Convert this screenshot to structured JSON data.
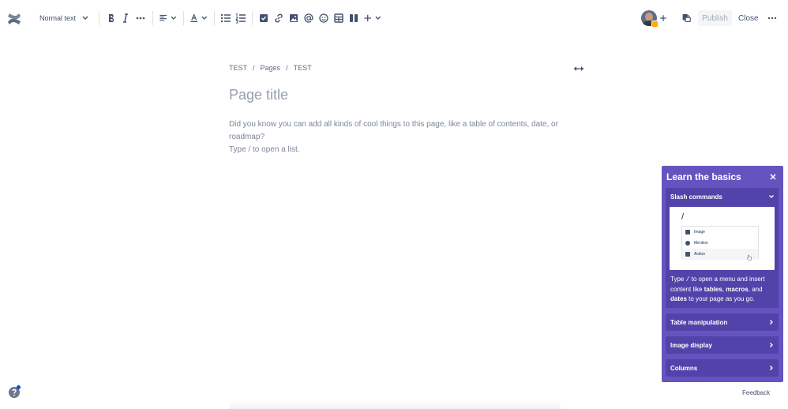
{
  "toolbar": {
    "text_style": "Normal text",
    "publish_label": "Publish",
    "close_label": "Close",
    "icons": [
      "confluence-logo-icon",
      "bold-icon",
      "italic-icon",
      "more-formatting-icon",
      "align-icon",
      "text-color-icon",
      "bullet-list-icon",
      "numbered-list-icon",
      "action-item-icon",
      "link-icon",
      "image-icon",
      "mention-icon",
      "emoji-icon",
      "table-icon",
      "layouts-icon",
      "insert-icon",
      "avatar",
      "invite-icon",
      "restrictions-icon",
      "more-icon"
    ]
  },
  "breadcrumb": {
    "items": [
      "TEST",
      "Pages",
      "TEST"
    ]
  },
  "editor": {
    "title_placeholder": "Page title",
    "body_placeholder_line1": "Did you know you can add all kinds of cool things to this page, like a table of contents, date, or roadmap?",
    "body_placeholder_line2": "Type / to open a list."
  },
  "learn_panel": {
    "title": "Learn the basics",
    "sections": [
      {
        "label": "Slash commands",
        "expanded": true,
        "demo": {
          "slash": "/",
          "menu": [
            "Image",
            "Mention",
            "Action"
          ]
        },
        "text": {
          "part1": "Type ",
          "code": "/",
          "part2": " to open a menu and insert content like ",
          "b1": "tables",
          "sep1": ", ",
          "b2": "macros",
          "sep2": ", and ",
          "b3": "dates",
          "part3": " to your page as you go."
        }
      },
      {
        "label": "Table manipulation",
        "expanded": false
      },
      {
        "label": "Image display",
        "expanded": false
      },
      {
        "label": "Columns",
        "expanded": false
      }
    ]
  },
  "footer": {
    "feedback_label": "Feedback"
  },
  "colors": {
    "panel": "#6554c0",
    "card": "#5243aa",
    "text_primary": "#172b4d",
    "placeholder": "#97a0af"
  }
}
